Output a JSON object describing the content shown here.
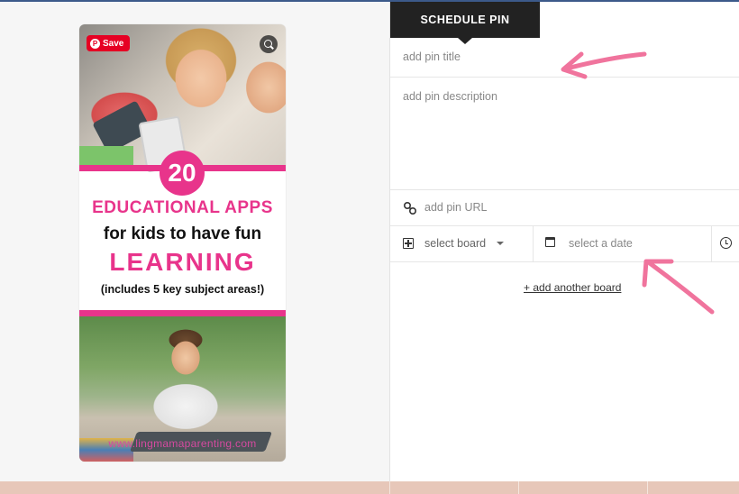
{
  "pin_image": {
    "save_label": "Save",
    "pinterest_logo": "pinterest-icon",
    "lens_icon": "visual-search-icon",
    "number": "20",
    "headline": "EDUCATIONAL APPS",
    "subline": "for kids to have fun",
    "keyword": "LEARNING",
    "note": "(includes 5 key subject areas!)",
    "site_url": "www.lingmamaparenting.com"
  },
  "scheduler": {
    "tab_label": "SCHEDULE PIN",
    "title_placeholder": "add pin title",
    "description_placeholder": "add pin description",
    "url_placeholder": "add pin URL",
    "board_label": "select board",
    "date_placeholder": "select a date",
    "add_board_link": "+ add another board"
  },
  "colors": {
    "accent_pink": "#e8348b",
    "pinterest_red": "#e60023",
    "arrow_pink": "#f0749d",
    "tab_dark": "#222222"
  }
}
